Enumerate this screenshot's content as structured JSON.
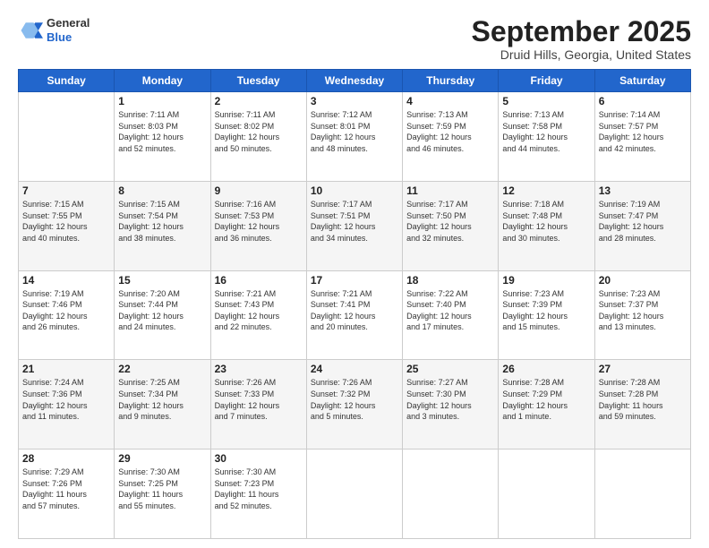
{
  "header": {
    "logo": {
      "general": "General",
      "blue": "Blue"
    },
    "month_title": "September 2025",
    "location": "Druid Hills, Georgia, United States"
  },
  "weekdays": [
    "Sunday",
    "Monday",
    "Tuesday",
    "Wednesday",
    "Thursday",
    "Friday",
    "Saturday"
  ],
  "weeks": [
    [
      {
        "day": "",
        "info": ""
      },
      {
        "day": "1",
        "info": "Sunrise: 7:11 AM\nSunset: 8:03 PM\nDaylight: 12 hours\nand 52 minutes."
      },
      {
        "day": "2",
        "info": "Sunrise: 7:11 AM\nSunset: 8:02 PM\nDaylight: 12 hours\nand 50 minutes."
      },
      {
        "day": "3",
        "info": "Sunrise: 7:12 AM\nSunset: 8:01 PM\nDaylight: 12 hours\nand 48 minutes."
      },
      {
        "day": "4",
        "info": "Sunrise: 7:13 AM\nSunset: 7:59 PM\nDaylight: 12 hours\nand 46 minutes."
      },
      {
        "day": "5",
        "info": "Sunrise: 7:13 AM\nSunset: 7:58 PM\nDaylight: 12 hours\nand 44 minutes."
      },
      {
        "day": "6",
        "info": "Sunrise: 7:14 AM\nSunset: 7:57 PM\nDaylight: 12 hours\nand 42 minutes."
      }
    ],
    [
      {
        "day": "7",
        "info": "Sunrise: 7:15 AM\nSunset: 7:55 PM\nDaylight: 12 hours\nand 40 minutes."
      },
      {
        "day": "8",
        "info": "Sunrise: 7:15 AM\nSunset: 7:54 PM\nDaylight: 12 hours\nand 38 minutes."
      },
      {
        "day": "9",
        "info": "Sunrise: 7:16 AM\nSunset: 7:53 PM\nDaylight: 12 hours\nand 36 minutes."
      },
      {
        "day": "10",
        "info": "Sunrise: 7:17 AM\nSunset: 7:51 PM\nDaylight: 12 hours\nand 34 minutes."
      },
      {
        "day": "11",
        "info": "Sunrise: 7:17 AM\nSunset: 7:50 PM\nDaylight: 12 hours\nand 32 minutes."
      },
      {
        "day": "12",
        "info": "Sunrise: 7:18 AM\nSunset: 7:48 PM\nDaylight: 12 hours\nand 30 minutes."
      },
      {
        "day": "13",
        "info": "Sunrise: 7:19 AM\nSunset: 7:47 PM\nDaylight: 12 hours\nand 28 minutes."
      }
    ],
    [
      {
        "day": "14",
        "info": "Sunrise: 7:19 AM\nSunset: 7:46 PM\nDaylight: 12 hours\nand 26 minutes."
      },
      {
        "day": "15",
        "info": "Sunrise: 7:20 AM\nSunset: 7:44 PM\nDaylight: 12 hours\nand 24 minutes."
      },
      {
        "day": "16",
        "info": "Sunrise: 7:21 AM\nSunset: 7:43 PM\nDaylight: 12 hours\nand 22 minutes."
      },
      {
        "day": "17",
        "info": "Sunrise: 7:21 AM\nSunset: 7:41 PM\nDaylight: 12 hours\nand 20 minutes."
      },
      {
        "day": "18",
        "info": "Sunrise: 7:22 AM\nSunset: 7:40 PM\nDaylight: 12 hours\nand 17 minutes."
      },
      {
        "day": "19",
        "info": "Sunrise: 7:23 AM\nSunset: 7:39 PM\nDaylight: 12 hours\nand 15 minutes."
      },
      {
        "day": "20",
        "info": "Sunrise: 7:23 AM\nSunset: 7:37 PM\nDaylight: 12 hours\nand 13 minutes."
      }
    ],
    [
      {
        "day": "21",
        "info": "Sunrise: 7:24 AM\nSunset: 7:36 PM\nDaylight: 12 hours\nand 11 minutes."
      },
      {
        "day": "22",
        "info": "Sunrise: 7:25 AM\nSunset: 7:34 PM\nDaylight: 12 hours\nand 9 minutes."
      },
      {
        "day": "23",
        "info": "Sunrise: 7:26 AM\nSunset: 7:33 PM\nDaylight: 12 hours\nand 7 minutes."
      },
      {
        "day": "24",
        "info": "Sunrise: 7:26 AM\nSunset: 7:32 PM\nDaylight: 12 hours\nand 5 minutes."
      },
      {
        "day": "25",
        "info": "Sunrise: 7:27 AM\nSunset: 7:30 PM\nDaylight: 12 hours\nand 3 minutes."
      },
      {
        "day": "26",
        "info": "Sunrise: 7:28 AM\nSunset: 7:29 PM\nDaylight: 12 hours\nand 1 minute."
      },
      {
        "day": "27",
        "info": "Sunrise: 7:28 AM\nSunset: 7:28 PM\nDaylight: 11 hours\nand 59 minutes."
      }
    ],
    [
      {
        "day": "28",
        "info": "Sunrise: 7:29 AM\nSunset: 7:26 PM\nDaylight: 11 hours\nand 57 minutes."
      },
      {
        "day": "29",
        "info": "Sunrise: 7:30 AM\nSunset: 7:25 PM\nDaylight: 11 hours\nand 55 minutes."
      },
      {
        "day": "30",
        "info": "Sunrise: 7:30 AM\nSunset: 7:23 PM\nDaylight: 11 hours\nand 52 minutes."
      },
      {
        "day": "",
        "info": ""
      },
      {
        "day": "",
        "info": ""
      },
      {
        "day": "",
        "info": ""
      },
      {
        "day": "",
        "info": ""
      }
    ]
  ]
}
